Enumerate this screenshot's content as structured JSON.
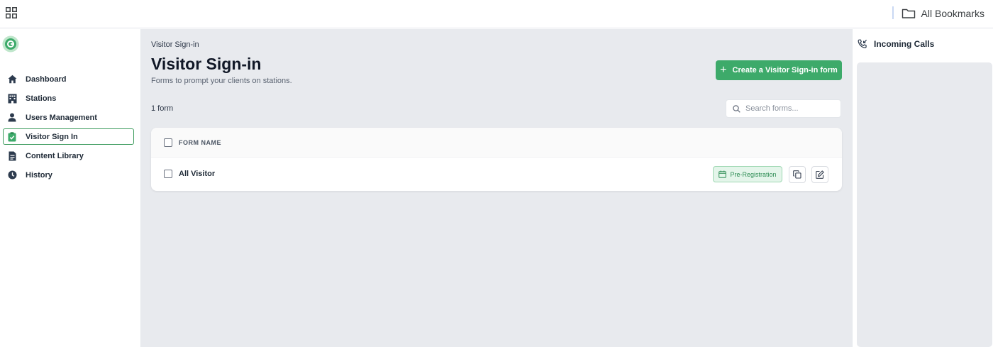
{
  "topbar": {
    "apps_icon": "grid-apps-icon",
    "bookmarks_label": "All Bookmarks",
    "bookmarks_icon": "folder-icon"
  },
  "sidebar": {
    "logo": "app-logo",
    "items": [
      {
        "label": "Dashboard",
        "icon": "home-icon",
        "active": false
      },
      {
        "label": "Stations",
        "icon": "building-icon",
        "active": false
      },
      {
        "label": "Users Management",
        "icon": "user-icon",
        "active": false
      },
      {
        "label": "Visitor Sign In",
        "icon": "clipboard-check-icon",
        "active": true
      },
      {
        "label": "Content Library",
        "icon": "document-icon",
        "active": false
      },
      {
        "label": "History",
        "icon": "clock-icon",
        "active": false
      }
    ]
  },
  "main": {
    "breadcrumb": "Visitor Sign-in",
    "title": "Visitor Sign-in",
    "subtitle": "Forms to prompt your clients on stations.",
    "create_button": "Create a Visitor Sign-in form",
    "count": "1 form",
    "search_placeholder": "Search forms...",
    "table": {
      "header": "FORM NAME",
      "rows": [
        {
          "name": "All Visitor",
          "badge": "Pre-Registration"
        }
      ]
    }
  },
  "right_panel": {
    "title": "Incoming Calls",
    "icon": "phone-incoming-icon"
  },
  "colors": {
    "accent": "#3daa6a",
    "badge_bg": "#e4f5ea",
    "badge_text": "#2f8d55",
    "nav_icon": "#2d3b4e",
    "content_bg": "#e8eaee"
  }
}
